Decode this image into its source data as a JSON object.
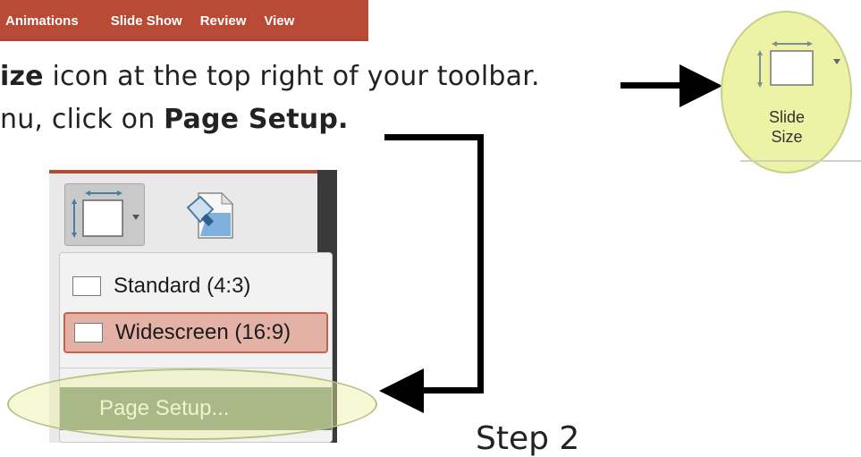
{
  "ribbon": {
    "tabs": [
      "Animations",
      "Slide Show",
      "Review",
      "View"
    ],
    "color": "#b94a36"
  },
  "instructions": {
    "line1_bold": "ize",
    "line1_rest": " icon at the top right of your toolbar.",
    "line2_prefix": "nu, click on ",
    "line2_bold": "Page Setup."
  },
  "slide_size_button": {
    "label_line1": "Slide",
    "label_line2": "Size",
    "icon": "slide-size-icon"
  },
  "dropdown": {
    "items": [
      {
        "label": "Standard (4:3)"
      },
      {
        "label": "Widescreen (16:9)"
      }
    ],
    "page_setup_label": "Page Setup..."
  },
  "step_label": "Step 2",
  "colors": {
    "highlight": "#eef2a4",
    "page_setup_bg": "#6f8a6f",
    "widescreen_bg": "#e3b1a6"
  }
}
